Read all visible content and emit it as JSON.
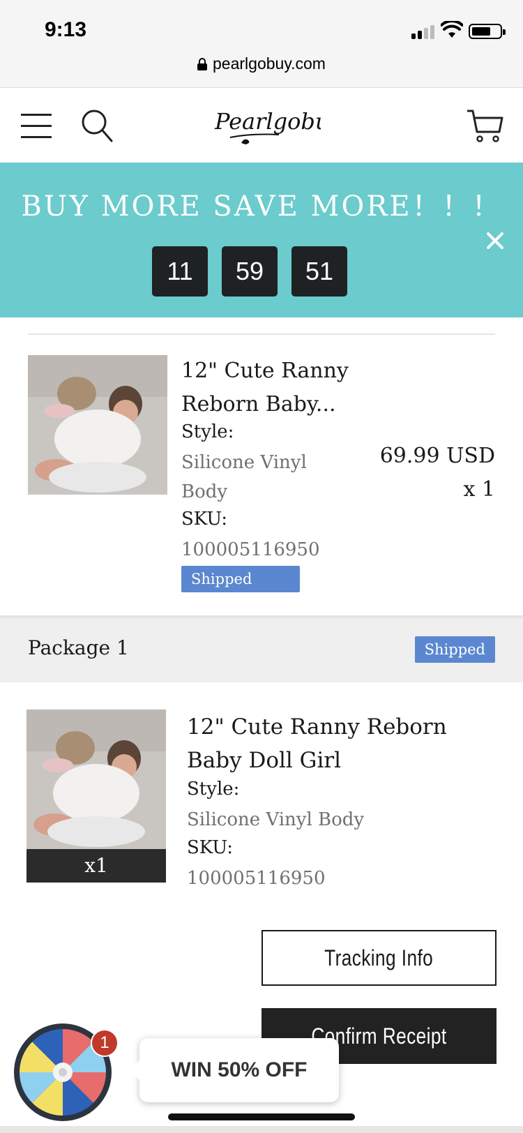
{
  "status_bar": {
    "time": "9:13",
    "url": "pearlgobuy.com"
  },
  "header": {
    "logo_text": "Pearlgobuy",
    "icons": [
      "menu-icon",
      "search-icon",
      "cart-icon"
    ]
  },
  "promo": {
    "title": "BUY MORE SAVE MORE！！！",
    "countdown": [
      "11",
      "59",
      "51"
    ],
    "background": "#6ccbcc"
  },
  "item1": {
    "name": "12\" Cute Ranny Reborn Baby...",
    "style_label": "Style:",
    "style_value": "Silicone Vinyl Body",
    "sku_label": "SKU:",
    "sku_value": "100005116950",
    "price": "69.99 USD",
    "quantity": "x 1",
    "status": "Shipped"
  },
  "package": {
    "title": "Package 1",
    "status": "Shipped",
    "badge_color": "#5b87d0"
  },
  "item2": {
    "name": "12\" Cute Ranny Reborn Baby Doll Girl",
    "quantity": "x1",
    "style_label": "Style:",
    "style_value": "Silicone Vinyl Body",
    "sku_label": "SKU:",
    "sku_value": "100005116950"
  },
  "actions": {
    "tracking_label": "Tracking Info",
    "confirm_label": "Confirm Receipt"
  },
  "promo_widget": {
    "badge_count": "1",
    "label": "WIN 50% OFF"
  }
}
